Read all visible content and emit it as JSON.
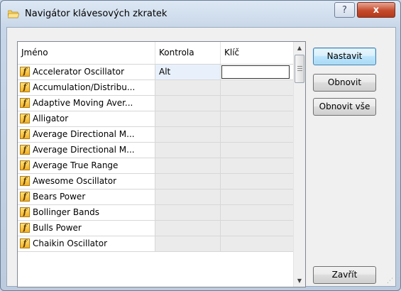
{
  "window": {
    "title": "Navigátor klávesových zkratek",
    "help_label": "?",
    "close_label": "x"
  },
  "grid": {
    "columns": [
      "Jméno",
      "Kontrola",
      "Klíč"
    ],
    "rows": [
      {
        "name": "Accelerator Oscillator",
        "control": "Alt",
        "key": ""
      },
      {
        "name": "Accumulation/Distribu...",
        "control": "",
        "key": ""
      },
      {
        "name": "Adaptive Moving Aver...",
        "control": "",
        "key": ""
      },
      {
        "name": "Alligator",
        "control": "",
        "key": ""
      },
      {
        "name": "Average Directional M...",
        "control": "",
        "key": ""
      },
      {
        "name": "Average Directional M...",
        "control": "",
        "key": ""
      },
      {
        "name": "Average True Range",
        "control": "",
        "key": ""
      },
      {
        "name": "Awesome Oscillator",
        "control": "",
        "key": ""
      },
      {
        "name": "Bears Power",
        "control": "",
        "key": ""
      },
      {
        "name": "Bollinger Bands",
        "control": "",
        "key": ""
      },
      {
        "name": "Bulls Power",
        "control": "",
        "key": ""
      },
      {
        "name": "Chaikin Oscillator",
        "control": "",
        "key": ""
      }
    ],
    "icon_glyph": "f"
  },
  "buttons": {
    "set": "Nastavit",
    "reset": "Obnovit",
    "reset_all": "Obnovit vše",
    "close": "Zavřít"
  },
  "colors": {
    "default_button_border": "#3c7fb1",
    "close_button": "#c54a2c",
    "function_icon": "#f2b124"
  }
}
